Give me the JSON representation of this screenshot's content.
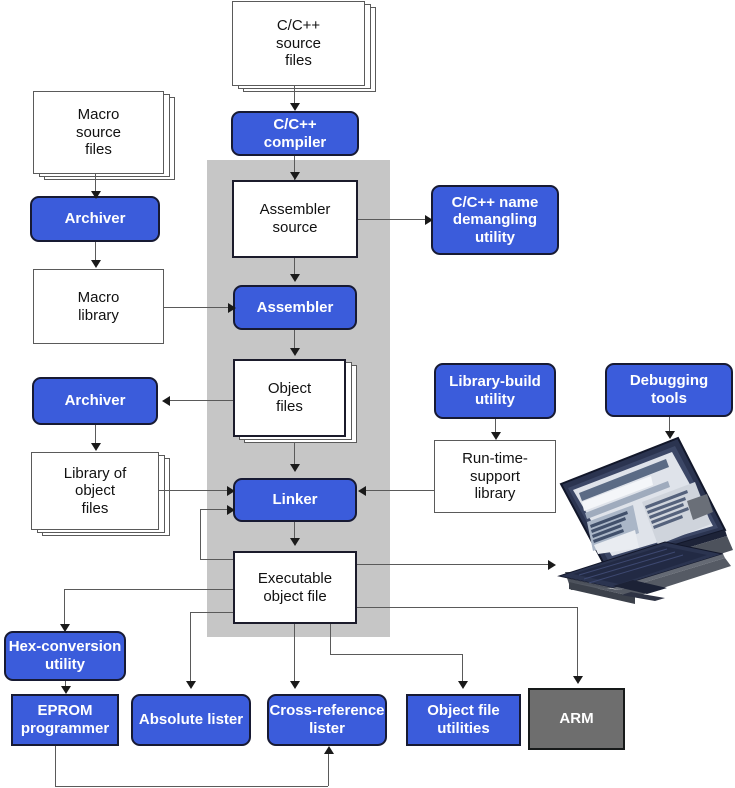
{
  "diagram": {
    "title": "ARM software development flow",
    "colors": {
      "tool_blue": "#3b5cdb",
      "tool_border": "#171a33",
      "band_gray": "#c6c6c6",
      "device_gray": "#6e6e6e",
      "line_gray": "#5a5a5a",
      "doc_border": "#1b1b2b",
      "text_on_blue": "#ffffff",
      "text_on_white": "#111111"
    },
    "nodes": {
      "cpp_source_files": "C/C++\nsource\nfiles",
      "cpp_compiler": "C/C++\ncompiler",
      "macro_source_files": "Macro\nsource\nfiles",
      "archiver_macro": "Archiver",
      "macro_library": "Macro\nlibrary",
      "assembler_source": "Assembler\nsource",
      "name_demangling": "C/C++ name\ndemangling\nutility",
      "assembler": "Assembler",
      "object_files": "Object\nfiles",
      "archiver_object": "Archiver",
      "library_of_object_files": "Library of\nobject\nfiles",
      "library_build_utility": "Library-build\nutility",
      "runtime_support_library": "Run-time-\nsupport\nlibrary",
      "debugging_tools": "Debugging\ntools",
      "linker": "Linker",
      "executable_object_file": "Executable\nobject file",
      "hex_conversion_utility": "Hex-conversion\nutility",
      "eprom_programmer": "EPROM\nprogrammer",
      "absolute_lister": "Absolute lister",
      "cross_reference_lister": "Cross-reference\nlister",
      "object_file_utilities": "Object file\nutilities",
      "arm": "ARM"
    },
    "lines": {
      "cpp_source_files_l1": "C/C++",
      "cpp_source_files_l2": "source",
      "cpp_source_files_l3": "files",
      "cpp_compiler_l1": "C/C++",
      "cpp_compiler_l2": "compiler",
      "macro_source_files_l1": "Macro",
      "macro_source_files_l2": "source",
      "macro_source_files_l3": "files",
      "macro_library_l1": "Macro",
      "macro_library_l2": "library",
      "assembler_source_l1": "Assembler",
      "assembler_source_l2": "source",
      "name_demangling_l1": "C/C++ name",
      "name_demangling_l2": "demangling",
      "name_demangling_l3": "utility",
      "object_files_l1": "Object",
      "object_files_l2": "files",
      "library_of_object_files_l1": "Library of",
      "library_of_object_files_l2": "object",
      "library_of_object_files_l3": "files",
      "library_build_utility_l1": "Library-build",
      "library_build_utility_l2": "utility",
      "runtime_support_library_l1": "Run-time-",
      "runtime_support_library_l2": "support",
      "runtime_support_library_l3": "library",
      "debugging_tools_l1": "Debugging",
      "debugging_tools_l2": "tools",
      "executable_object_file_l1": "Executable",
      "executable_object_file_l2": "object file",
      "hex_conversion_utility_l1": "Hex-conversion",
      "hex_conversion_utility_l2": "utility",
      "eprom_programmer_l1": "EPROM",
      "eprom_programmer_l2": "programmer",
      "cross_reference_lister_l1": "Cross-reference",
      "cross_reference_lister_l2": "lister",
      "object_file_utilities_l1": "Object file",
      "object_file_utilities_l2": "utilities"
    }
  }
}
